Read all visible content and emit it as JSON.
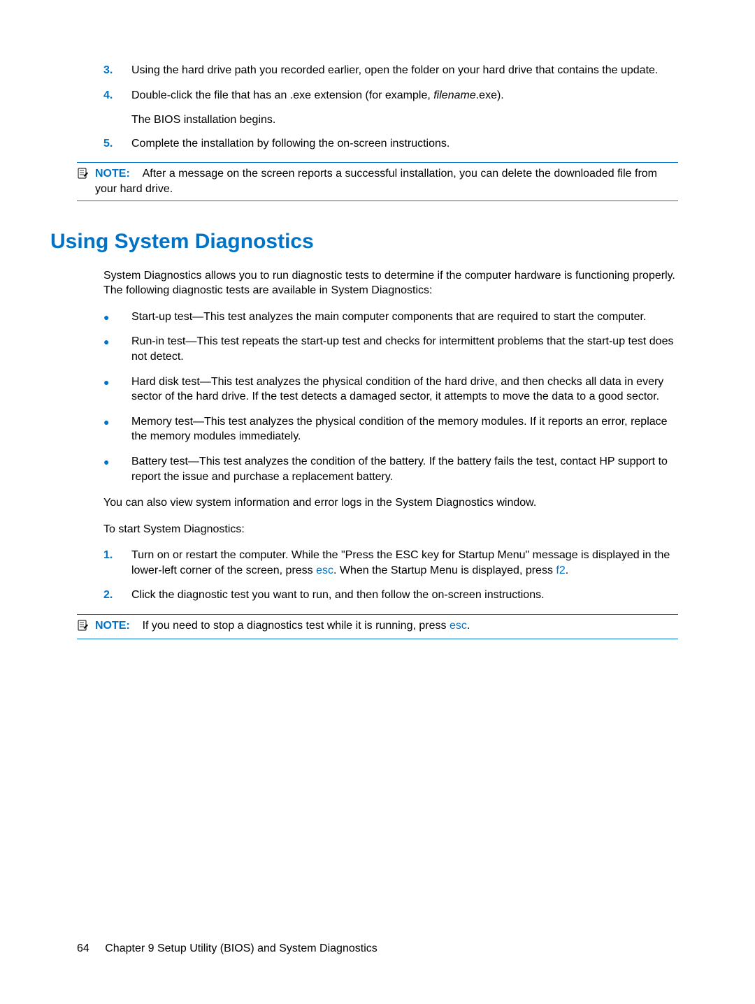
{
  "ol1": {
    "items": [
      {
        "num": "3.",
        "text": "Using the hard drive path you recorded earlier, open the folder on your hard drive that contains the update."
      },
      {
        "num": "4.",
        "text_pre": "Double-click the file that has an .exe extension (for example, ",
        "italic": "filename",
        "text_post": ".exe)."
      }
    ],
    "continuation": "The BIOS installation begins.",
    "item5": {
      "num": "5.",
      "text": "Complete the installation by following the on-screen instructions."
    }
  },
  "note1": {
    "label": "NOTE:",
    "text": "After a message on the screen reports a successful installation, you can delete the downloaded file from your hard drive."
  },
  "h1": "Using System Diagnostics",
  "intro": "System Diagnostics allows you to run diagnostic tests to determine if the computer hardware is functioning properly. The following diagnostic tests are available in System Diagnostics:",
  "ul1": [
    "Start-up test—This test analyzes the main computer components that are required to start the computer.",
    "Run-in test—This test repeats the start-up test and checks for intermittent problems that the start-up test does not detect.",
    "Hard disk test—This test analyzes the physical condition of the hard drive, and then checks all data in every sector of the hard drive. If the test detects a damaged sector, it attempts to move the data to a good sector.",
    "Memory test—This test analyzes the physical condition of the memory modules. If it reports an error, replace the memory modules immediately.",
    "Battery test—This test analyzes the condition of the battery. If the battery fails the test, contact HP support to report the issue and purchase a replacement battery."
  ],
  "para2": "You can also view system information and error logs in the System Diagnostics window.",
  "para3": "To start System Diagnostics:",
  "ol2": {
    "item1": {
      "num": "1.",
      "t1": "Turn on or restart the computer. While the \"Press the ESC key for Startup Menu\" message is displayed in the lower-left corner of the screen, press ",
      "k1": "esc",
      "t2": ". When the Startup Menu is displayed, press ",
      "k2": "f2",
      "t3": "."
    },
    "item2": {
      "num": "2.",
      "text": "Click the diagnostic test you want to run, and then follow the on-screen instructions."
    }
  },
  "note2": {
    "label": "NOTE:",
    "t1": "If you need to stop a diagnostics test while it is running, press ",
    "k1": "esc",
    "t2": "."
  },
  "footer": {
    "page": "64",
    "chapter": "Chapter 9   Setup Utility (BIOS) and System Diagnostics"
  }
}
